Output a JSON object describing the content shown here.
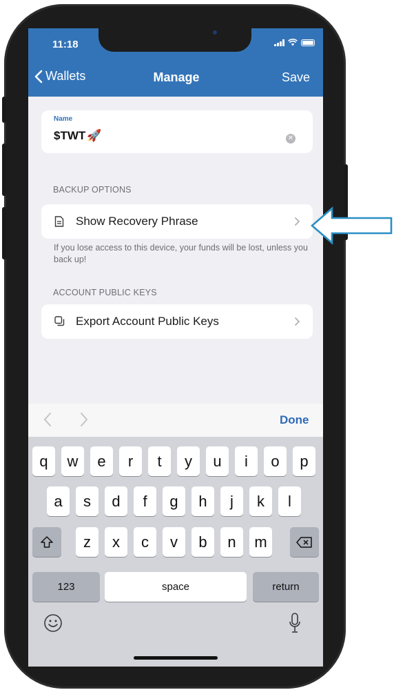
{
  "status_bar": {
    "time": "11:18"
  },
  "nav": {
    "back_label": "Wallets",
    "title": "Manage",
    "save_label": "Save"
  },
  "name_field": {
    "label": "Name",
    "value": "$TWT",
    "emoji": "🚀"
  },
  "backup": {
    "section_label": "BACKUP OPTIONS",
    "row_label": "Show Recovery Phrase",
    "hint": "If you lose access to this device, your funds will be lost, unless you back up!"
  },
  "keys": {
    "section_label": "ACCOUNT PUBLIC KEYS",
    "row_label": "Export Account Public Keys"
  },
  "keyboard": {
    "done_label": "Done",
    "row1": [
      "q",
      "w",
      "e",
      "r",
      "t",
      "y",
      "u",
      "i",
      "o",
      "p"
    ],
    "row2": [
      "a",
      "s",
      "d",
      "f",
      "g",
      "h",
      "j",
      "k",
      "l"
    ],
    "row3": [
      "z",
      "x",
      "c",
      "v",
      "b",
      "n",
      "m"
    ],
    "numbers_label": "123",
    "space_label": "space",
    "return_label": "return"
  },
  "colors": {
    "accent": "#3374b8",
    "annotation_arrow": "#2a8fc4"
  }
}
